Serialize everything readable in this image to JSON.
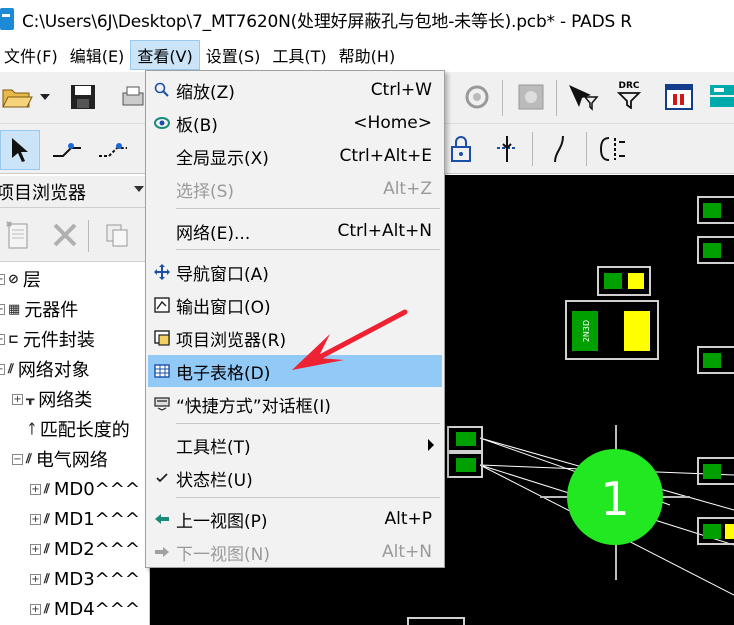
{
  "window": {
    "title": "C:\\Users\\6J\\Desktop\\7_MT7620N(处理好屏蔽孔与包地-未等长).pcb* - PADS R"
  },
  "menubar": {
    "items": [
      {
        "label": "文件(F)"
      },
      {
        "label": "编辑(E)"
      },
      {
        "label": "查看(V)"
      },
      {
        "label": "设置(S)"
      },
      {
        "label": "工具(T)"
      },
      {
        "label": "帮助(H)"
      }
    ]
  },
  "toolbar": {
    "drc_label": "DRC"
  },
  "project_browser": {
    "title": "项目浏览器",
    "tree": [
      {
        "label": "层",
        "level": 0,
        "expander": "+",
        "icon": "layers-icon"
      },
      {
        "label": "元器件",
        "level": 0,
        "expander": "+",
        "icon": "component-icon"
      },
      {
        "label": "元件封装",
        "level": 0,
        "expander": "+",
        "icon": "footprint-icon"
      },
      {
        "label": "网络对象",
        "level": 0,
        "expander": "-",
        "icon": "net-objects-icon"
      },
      {
        "label": "网络类",
        "level": 1,
        "expander": "+",
        "icon": "net-class-icon"
      },
      {
        "label": "匹配长度的",
        "level": 1,
        "expander": "",
        "icon": "matched-length-icon"
      },
      {
        "label": "电气网络",
        "level": 1,
        "expander": "-",
        "icon": "electrical-net-icon"
      },
      {
        "label": "MD0^^^",
        "level": 2,
        "expander": "+",
        "icon": "net-icon"
      },
      {
        "label": "MD1^^^",
        "level": 2,
        "expander": "+",
        "icon": "net-icon"
      },
      {
        "label": "MD2^^^",
        "level": 2,
        "expander": "+",
        "icon": "net-icon"
      },
      {
        "label": "MD3^^^",
        "level": 2,
        "expander": "+",
        "icon": "net-icon"
      },
      {
        "label": "MD4^^^",
        "level": 2,
        "expander": "+",
        "icon": "net-icon"
      }
    ]
  },
  "view_menu": {
    "items": [
      {
        "label": "缩放(Z)",
        "shortcut": "Ctrl+W",
        "icon": "zoom-icon",
        "enabled": true
      },
      {
        "label": "板(B)",
        "shortcut": "<Home>",
        "icon": "board-icon",
        "enabled": true
      },
      {
        "label": "全局显示(X)",
        "shortcut": "Ctrl+Alt+E",
        "icon": "",
        "enabled": true
      },
      {
        "label": "选择(S)",
        "shortcut": "Alt+Z",
        "icon": "",
        "enabled": false
      },
      {
        "label": "网络(E)...",
        "shortcut": "Ctrl+Alt+N",
        "icon": "",
        "enabled": true
      },
      {
        "label": "导航窗口(A)",
        "shortcut": "",
        "icon": "navigation-icon",
        "enabled": true
      },
      {
        "label": "输出窗口(O)",
        "shortcut": "",
        "icon": "output-window-icon",
        "enabled": true
      },
      {
        "label": "项目浏览器(R)",
        "shortcut": "",
        "icon": "project-browser-icon",
        "enabled": true
      },
      {
        "label": "电子表格(D)",
        "shortcut": "",
        "icon": "spreadsheet-icon",
        "enabled": true
      },
      {
        "label": "“快捷方式”对话框(I)",
        "shortcut": "",
        "icon": "shortcut-dialog-icon",
        "enabled": true
      },
      {
        "label": "工具栏(T)",
        "shortcut": "",
        "icon": "",
        "enabled": true
      },
      {
        "label": "状态栏(U)",
        "shortcut": "",
        "icon": "checkmark-icon",
        "enabled": true
      },
      {
        "label": "上一视图(P)",
        "shortcut": "Alt+P",
        "icon": "back-arrow-icon",
        "enabled": true
      },
      {
        "label": "下一视图(N)",
        "shortcut": "Alt+N",
        "icon": "forward-arrow-icon",
        "enabled": false
      }
    ]
  },
  "pcb": {
    "component_label": "2N3D",
    "pad_number": "1"
  },
  "colors": {
    "menu_highlight": "#91c9f7",
    "pcb_background": "#000000",
    "pad_green": "#00ff00",
    "pad_yellow": "#ffff00",
    "annotation_arrow": "#ee2233"
  }
}
